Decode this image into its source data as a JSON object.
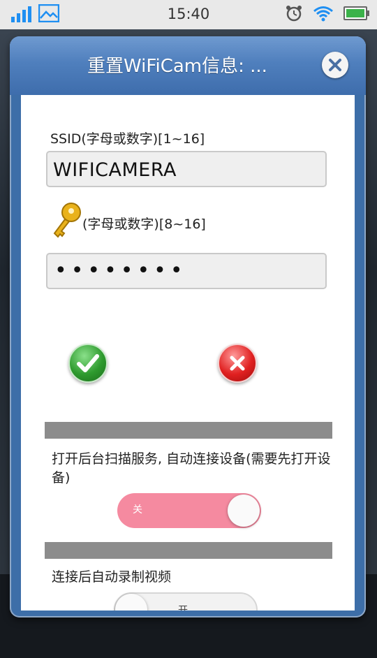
{
  "status_bar": {
    "time": "15:40",
    "icons": [
      "signal-icon",
      "image-icon",
      "alarm-icon",
      "wifi-icon",
      "battery-icon"
    ]
  },
  "dialog": {
    "title": "重置WiFiCam信息: ...",
    "close_icon": "close-icon",
    "ssid_label": "SSID(字母或数字)[1~16]",
    "ssid_value": "WIFICAMERA",
    "password_label": "(字母或数字)[8~16]",
    "password_value": "••••••••",
    "confirm_icon": "check-icon",
    "cancel_icon": "x-icon",
    "scan_service_label": "打开后台扫描服务, 自动连接设备(需要先打开设备)",
    "scan_service_toggle_text": "关",
    "auto_record_label": "连接后自动录制视频",
    "auto_record_toggle_text": "开"
  },
  "colors": {
    "accent_blue": "#1f8ff2",
    "dialog_header": "#4f7fbd",
    "toggle_pink": "#f58aa0",
    "confirm_green": "#2e9a2e",
    "cancel_red": "#e02020",
    "divider_gray": "#8c8c8c"
  }
}
